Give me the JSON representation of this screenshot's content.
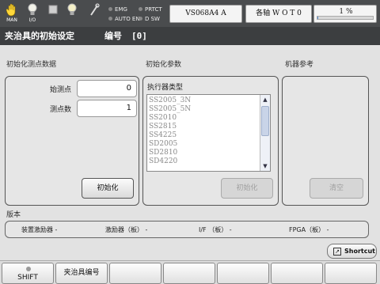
{
  "status_bar": {
    "man_icon": "hand-icon",
    "man_label": "MAN",
    "io_label": "I/O",
    "indicators": {
      "emg": "EMG",
      "auto_en": "AUTO EN",
      "prtct": "PRTCT",
      "dsw": "D SW"
    },
    "program": "VS068A4 A",
    "axis_mode": "各轴  W O T 0",
    "speed_text": "1  %",
    "speed_percent": 1
  },
  "title_bar": {
    "title": "夹治具的初始设定",
    "number_label": "编号",
    "number_value": "[0]"
  },
  "init_points": {
    "section_title": "初始化测点数据",
    "start_label": "始测点",
    "start_value": "0",
    "count_label": "测点数",
    "count_value": "1",
    "init_button": "初始化"
  },
  "init_params": {
    "section_title": "初始化参数",
    "actuator_label": "执行器类型",
    "actuator_options": [
      "SS2005_3N",
      "SS2005_5N",
      "SS2010",
      "SS2815",
      "SS4225",
      "SD2005",
      "SD2810",
      "SD4220"
    ],
    "init_button": "初始化"
  },
  "machine_ref": {
    "section_title": "机器参考",
    "clear_button": "清空"
  },
  "version": {
    "title": "版本",
    "items": [
      "装置激励器 -",
      "激励器（板） -",
      "I/F （板） -",
      "FPGA（板） -"
    ]
  },
  "shortcut": {
    "label": "Shortcut"
  },
  "function_keys": {
    "shift": "SHIFT",
    "jig_number": "夹治具编号",
    "empty": [
      "",
      "",
      "",
      "",
      ""
    ]
  },
  "colors": {
    "topbar": "#4a4c4e",
    "titlebar": "#3c3e40",
    "background": "#e2e2e2",
    "progress": "#5b8fd0"
  }
}
